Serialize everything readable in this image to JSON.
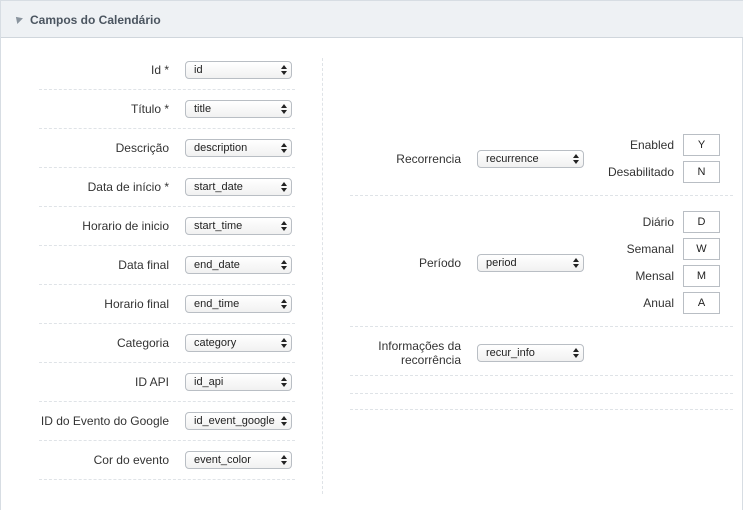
{
  "panel": {
    "title": "Campos do Calendário"
  },
  "left_fields": [
    {
      "label": "Id *",
      "value": "id"
    },
    {
      "label": "Título *",
      "value": "title"
    },
    {
      "label": "Descrição",
      "value": "description"
    },
    {
      "label": "Data de início *",
      "value": "start_date"
    },
    {
      "label": "Horario de inicio",
      "value": "start_time"
    },
    {
      "label": "Data final",
      "value": "end_date"
    },
    {
      "label": "Horario final",
      "value": "end_time"
    },
    {
      "label": "Categoria",
      "value": "category"
    },
    {
      "label": "ID API",
      "value": "id_api"
    },
    {
      "label": "ID do Evento do Google",
      "value": "id_event_google"
    },
    {
      "label": "Cor do evento",
      "value": "event_color"
    }
  ],
  "recurrence": {
    "label": "Recorrencia",
    "value": "recurrence",
    "options": [
      {
        "label": "Enabled",
        "value": "Y"
      },
      {
        "label": "Desabilitado",
        "value": "N"
      }
    ]
  },
  "period": {
    "label": "Período",
    "value": "period",
    "options": [
      {
        "label": "Diário",
        "value": "D"
      },
      {
        "label": "Semanal",
        "value": "W"
      },
      {
        "label": "Mensal",
        "value": "M"
      },
      {
        "label": "Anual",
        "value": "A"
      }
    ]
  },
  "recur_info": {
    "label_line1": "Informações da",
    "label_line2": "recorrência",
    "value": "recur_info"
  }
}
